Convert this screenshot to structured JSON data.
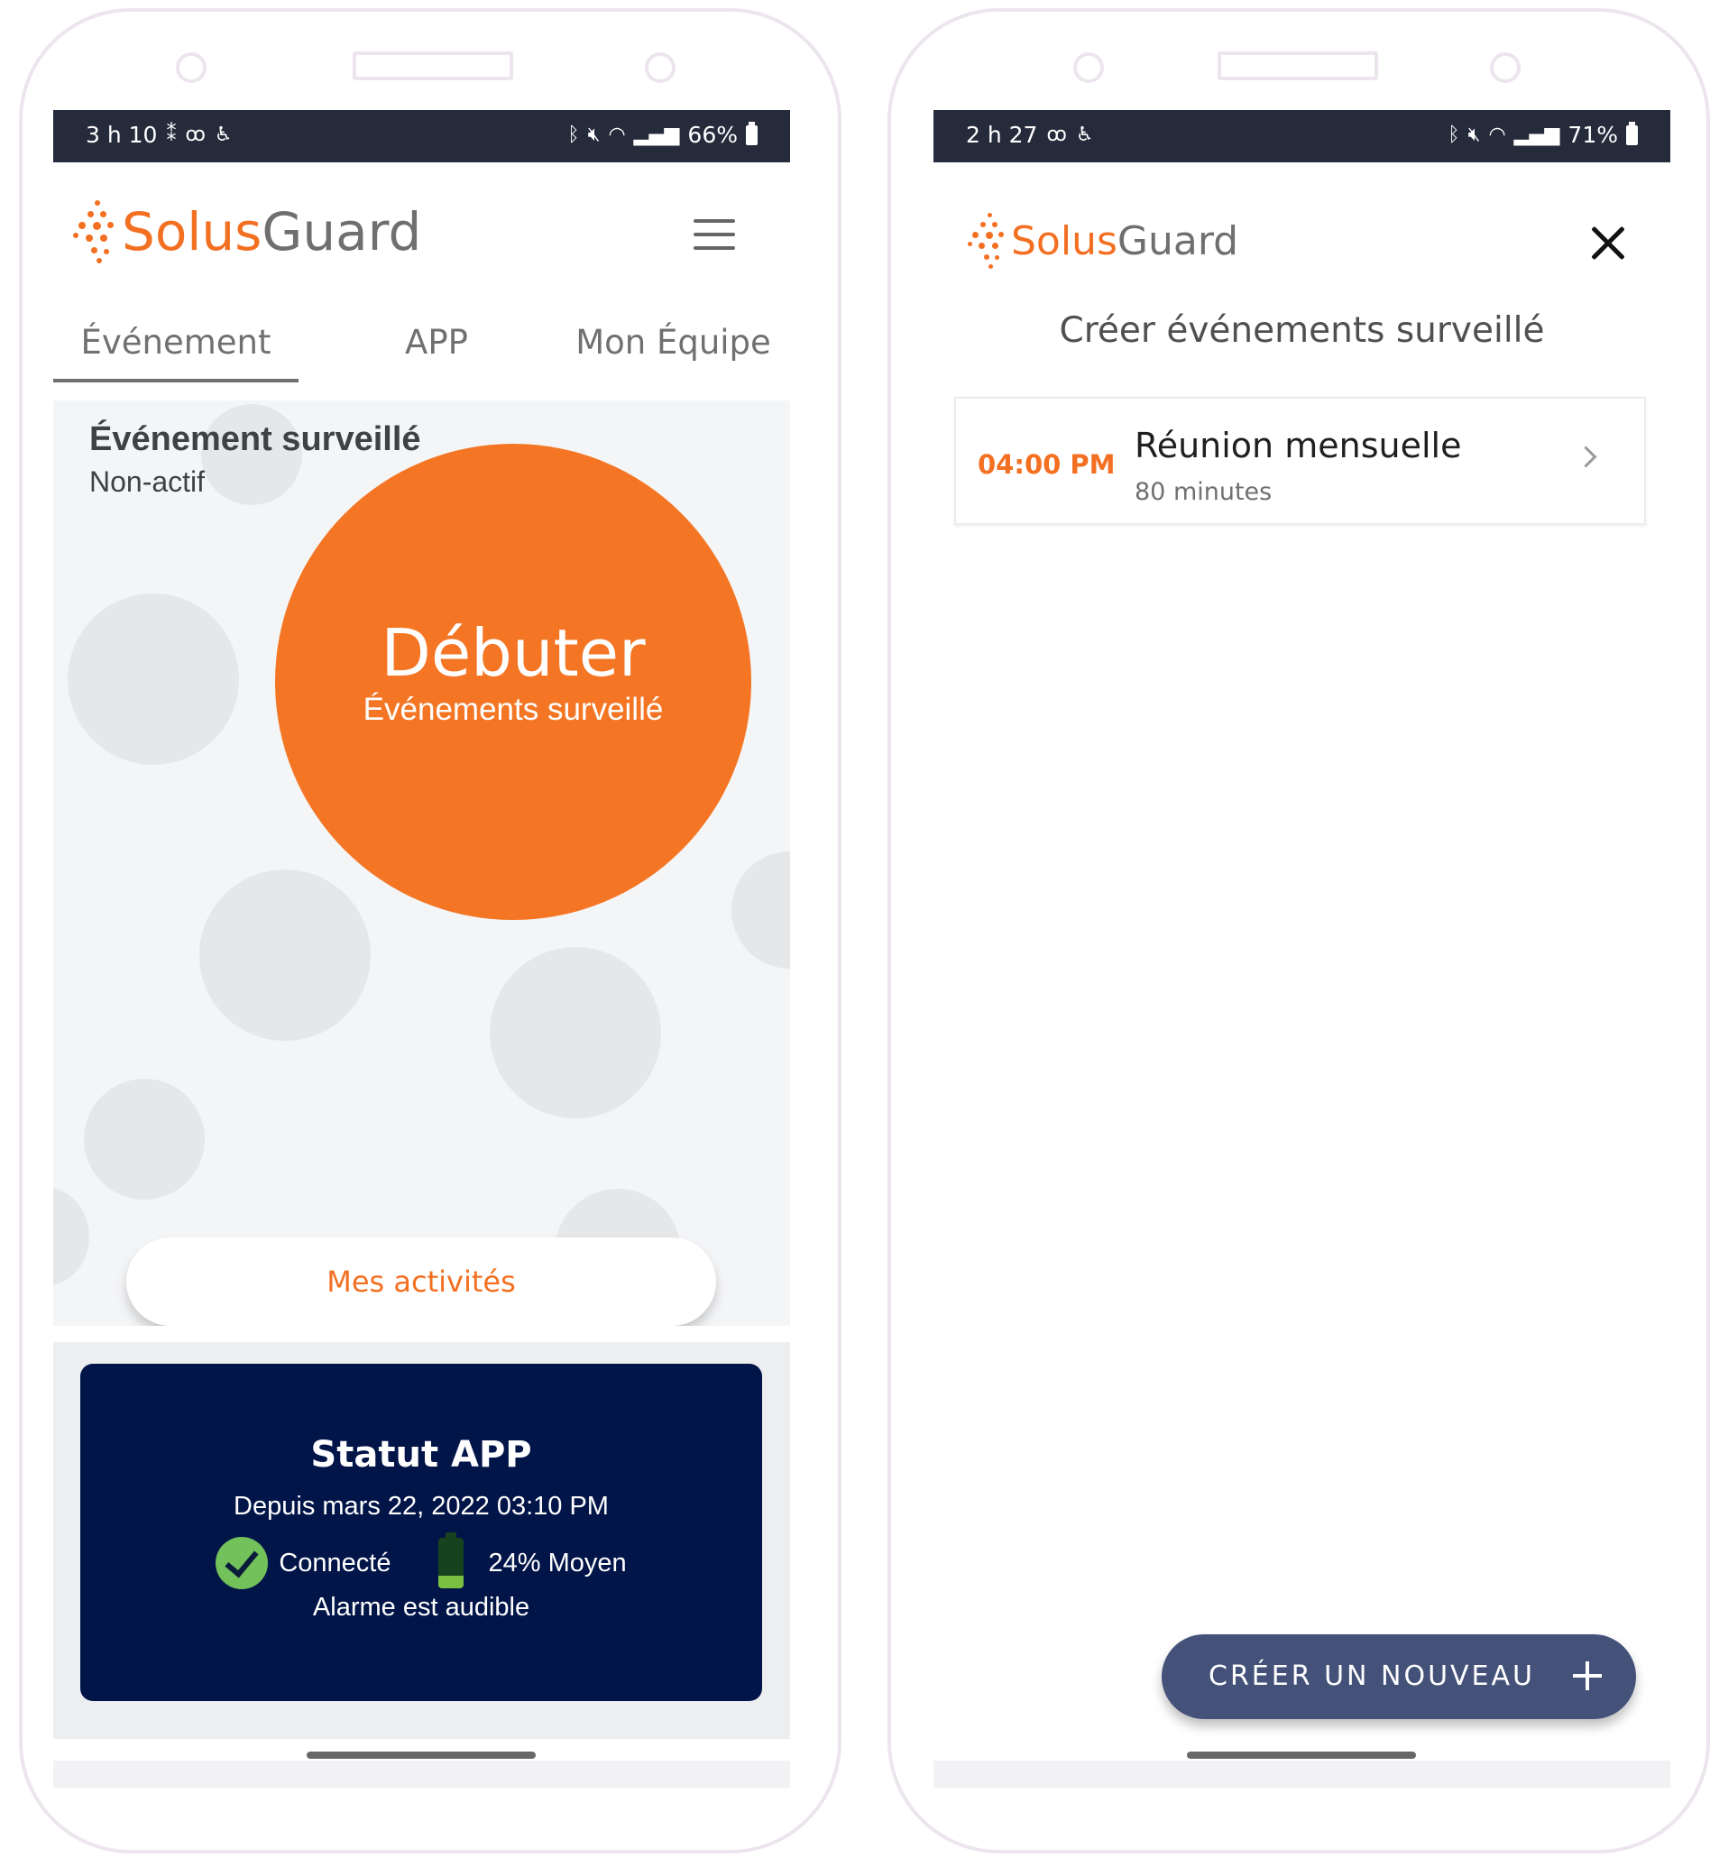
{
  "screen1": {
    "statusbar": {
      "time": "3 h 10",
      "battery": "66%"
    },
    "logo": {
      "part1": "Solus",
      "part2": "Guard"
    },
    "tabs": [
      {
        "label": "Événement",
        "active": true
      },
      {
        "label": "APP",
        "active": false
      },
      {
        "label": "Mon Équipe",
        "active": false
      }
    ],
    "event": {
      "title": "Événement  surveillé",
      "state": "Non-actif",
      "start_button": {
        "title": "Débuter",
        "subtitle": "Événements surveillé"
      },
      "activities_button": "Mes activités"
    },
    "status_card": {
      "title": "Statut APP",
      "since": "Depuis mars 22, 2022 03:10 PM",
      "connection": "Connecté",
      "battery": "24% Moyen",
      "alarm": "Alarme est audible"
    }
  },
  "screen2": {
    "statusbar": {
      "time": "2 h 27",
      "battery": "71%"
    },
    "logo": {
      "part1": "Solus",
      "part2": "Guard"
    },
    "page_title": "Créer événements surveillé",
    "events": [
      {
        "time": "04:00 PM",
        "name": "Réunion mensuelle",
        "duration": "80 minutes"
      }
    ],
    "fab_label": "CRÉER UN NOUVEAU"
  },
  "colors": {
    "brand_orange": "#f36f21",
    "status_bar": "#252b3b",
    "status_card": "#021548",
    "fab": "#44527a",
    "connected_green": "#72c15a"
  },
  "icons": [
    "voicemail-icon",
    "accessibility-icon",
    "bluetooth-icon",
    "mute-icon",
    "wifi-icon",
    "signal-icon",
    "battery-icon",
    "menu-icon",
    "close-icon",
    "chevron-right-icon",
    "check-circle-icon",
    "plus-icon"
  ]
}
